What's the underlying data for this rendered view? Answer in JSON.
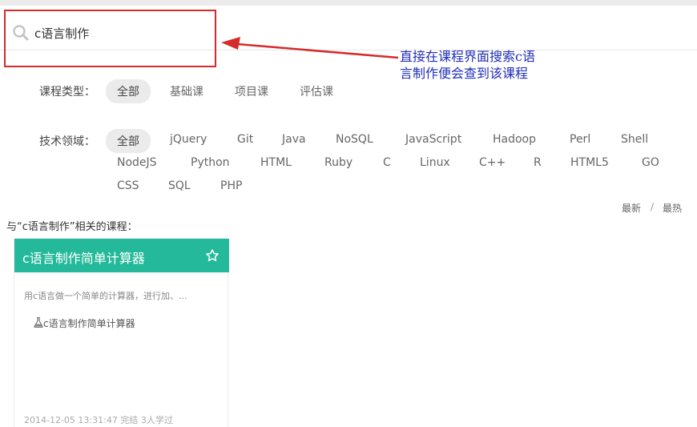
{
  "search": {
    "value": "c语言制作"
  },
  "filters": {
    "course_type_label": "课程类型：",
    "course_types": [
      "全部",
      "基础课",
      "项目课",
      "评估课"
    ],
    "tech_label": "技术领域：",
    "tech_row1": [
      "全部",
      "jQuery",
      "Git",
      "Java",
      "NoSQL",
      "JavaScript",
      "Hadoop",
      "Perl",
      "Shell"
    ],
    "tech_row2": [
      "NodeJS",
      "Python",
      "HTML",
      "Ruby",
      "C",
      "Linux",
      "C++",
      "R",
      "HTML5",
      "GO"
    ],
    "tech_row3": [
      "CSS",
      "SQL",
      "PHP"
    ]
  },
  "sort": {
    "newest": "最新",
    "sep": "/",
    "hottest": "最热"
  },
  "results": {
    "title": "与“c语言制作”相关的课程：",
    "card": {
      "title": "c语言制作简单计算器",
      "description": "用c语言做一个简单的计算器，进行加、...",
      "lab": "c语言制作简单计算器",
      "footer": "2014-12-05 13:31:47 完结   3人学过"
    }
  },
  "annotation": {
    "line1": "直接在课程界面搜索c语",
    "line2": "言制作便会查到该课程"
  },
  "colors": {
    "accent": "#24b99a",
    "annotation": "#1f2fb8",
    "highlight": "#d62b2b"
  }
}
